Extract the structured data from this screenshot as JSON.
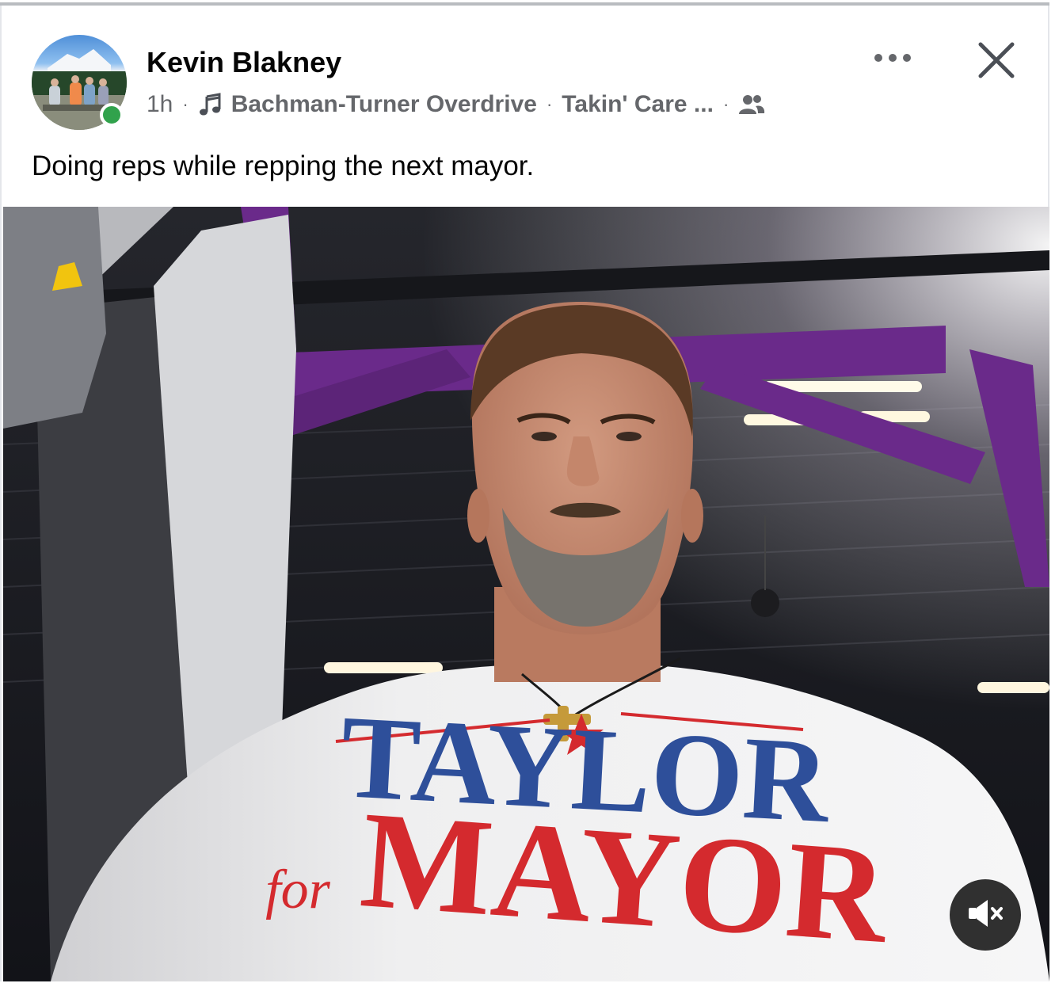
{
  "post": {
    "author": "Kevin Blakney",
    "time": "1h",
    "separator": "·",
    "song_artist": "Bachman-Turner Overdrive",
    "song_title": "Takin' Care ...",
    "caption": "Doing reps while repping the next mayor."
  },
  "photo": {
    "shirt_line1": "TAYLOR",
    "shirt_for": "for",
    "shirt_line2": "MAYOR"
  },
  "icons": {
    "music": "music-note-icon",
    "audience": "friends-audience-icon",
    "more": "more-options-icon",
    "close": "close-icon",
    "mute": "muted-speaker-icon"
  },
  "colors": {
    "accent_purple": "#6a2a8a",
    "shirt_blue": "#2e4f9a",
    "shirt_red": "#d42a2e",
    "online_green": "#31a24c"
  }
}
